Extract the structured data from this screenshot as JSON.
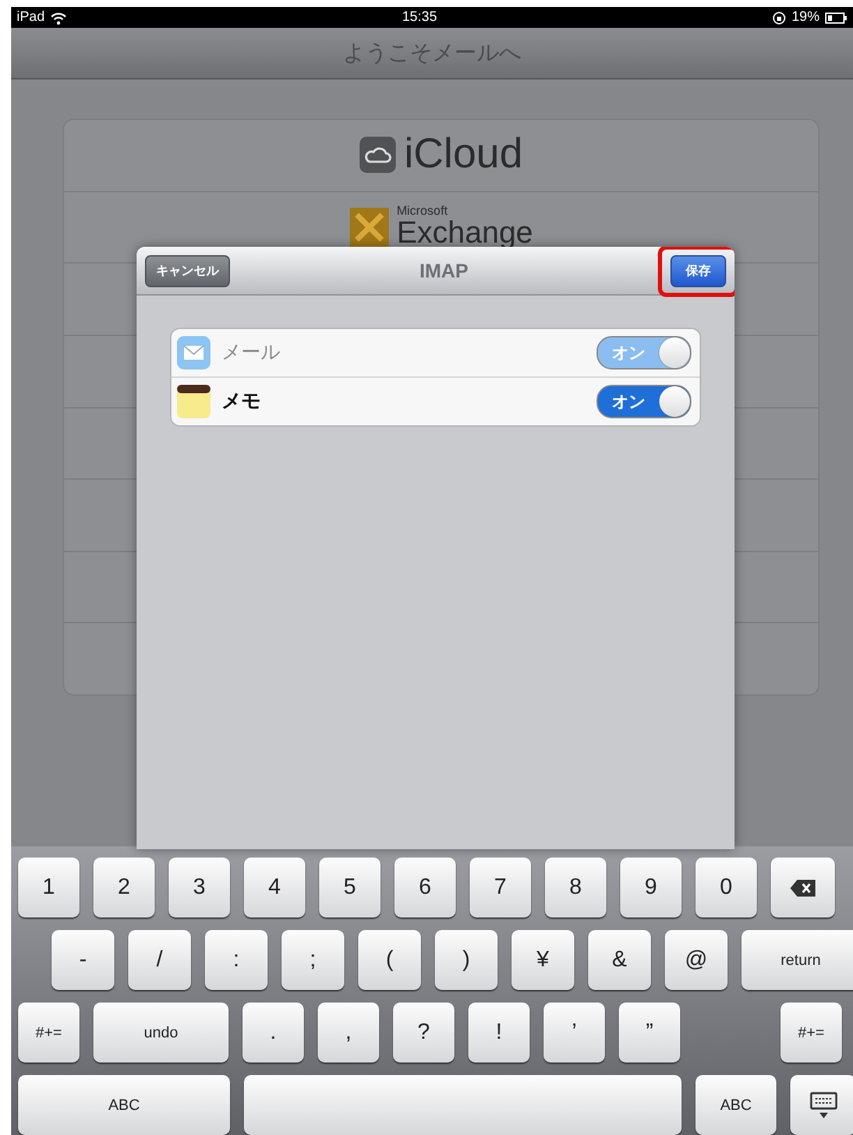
{
  "status_bar": {
    "carrier": "iPad",
    "time": "15:35",
    "battery": "19%"
  },
  "nav_bar": {
    "title": "ようこそメールへ"
  },
  "providers": [
    {
      "kind": "icloud",
      "label": "iCloud"
    },
    {
      "kind": "exchange",
      "label": "Exchange",
      "sublabel": "Microsoft"
    }
  ],
  "dialog": {
    "title": "IMAP",
    "cancel_button": "キャンセル",
    "save_button": {
      "label": "保存",
      "highlighted": true
    },
    "services": [
      {
        "kind": "mail",
        "label": "メール",
        "on": true,
        "on_label": "オン",
        "disabled": true
      },
      {
        "kind": "notes",
        "label": "メモ",
        "on": true,
        "on_label": "オン",
        "disabled": false
      }
    ]
  },
  "keyboard": {
    "rows": [
      [
        {
          "kind": "key",
          "label": "1"
        },
        {
          "kind": "key",
          "label": "2"
        },
        {
          "kind": "key",
          "label": "3"
        },
        {
          "kind": "key",
          "label": "4"
        },
        {
          "kind": "key",
          "label": "5"
        },
        {
          "kind": "key",
          "label": "6"
        },
        {
          "kind": "key",
          "label": "7"
        },
        {
          "kind": "key",
          "label": "8"
        },
        {
          "kind": "key",
          "label": "9"
        },
        {
          "kind": "key",
          "label": "0"
        },
        {
          "kind": "delete"
        }
      ],
      [
        {
          "kind": "key",
          "label": "-"
        },
        {
          "kind": "key",
          "label": "/"
        },
        {
          "kind": "key",
          "label": ":"
        },
        {
          "kind": "key",
          "label": ";"
        },
        {
          "kind": "key",
          "label": "("
        },
        {
          "kind": "key",
          "label": ")"
        },
        {
          "kind": "key",
          "label": "¥"
        },
        {
          "kind": "key",
          "label": "&"
        },
        {
          "kind": "key",
          "label": "@"
        },
        {
          "kind": "wide",
          "label": "return"
        }
      ],
      [
        {
          "kind": "small",
          "label": "#+="
        },
        {
          "kind": "wide",
          "label": "undo"
        },
        {
          "kind": "key",
          "label": "."
        },
        {
          "kind": "key",
          "label": ","
        },
        {
          "kind": "key",
          "label": "?"
        },
        {
          "kind": "key",
          "label": "!"
        },
        {
          "kind": "key",
          "label": "’"
        },
        {
          "kind": "key",
          "label": "”"
        },
        {
          "kind": "gap"
        },
        {
          "kind": "small",
          "label": "#+="
        }
      ],
      [
        {
          "kind": "mode",
          "label": "ABC"
        },
        {
          "kind": "space"
        },
        {
          "kind": "small",
          "label": "ABC"
        },
        {
          "kind": "hide"
        }
      ]
    ]
  }
}
